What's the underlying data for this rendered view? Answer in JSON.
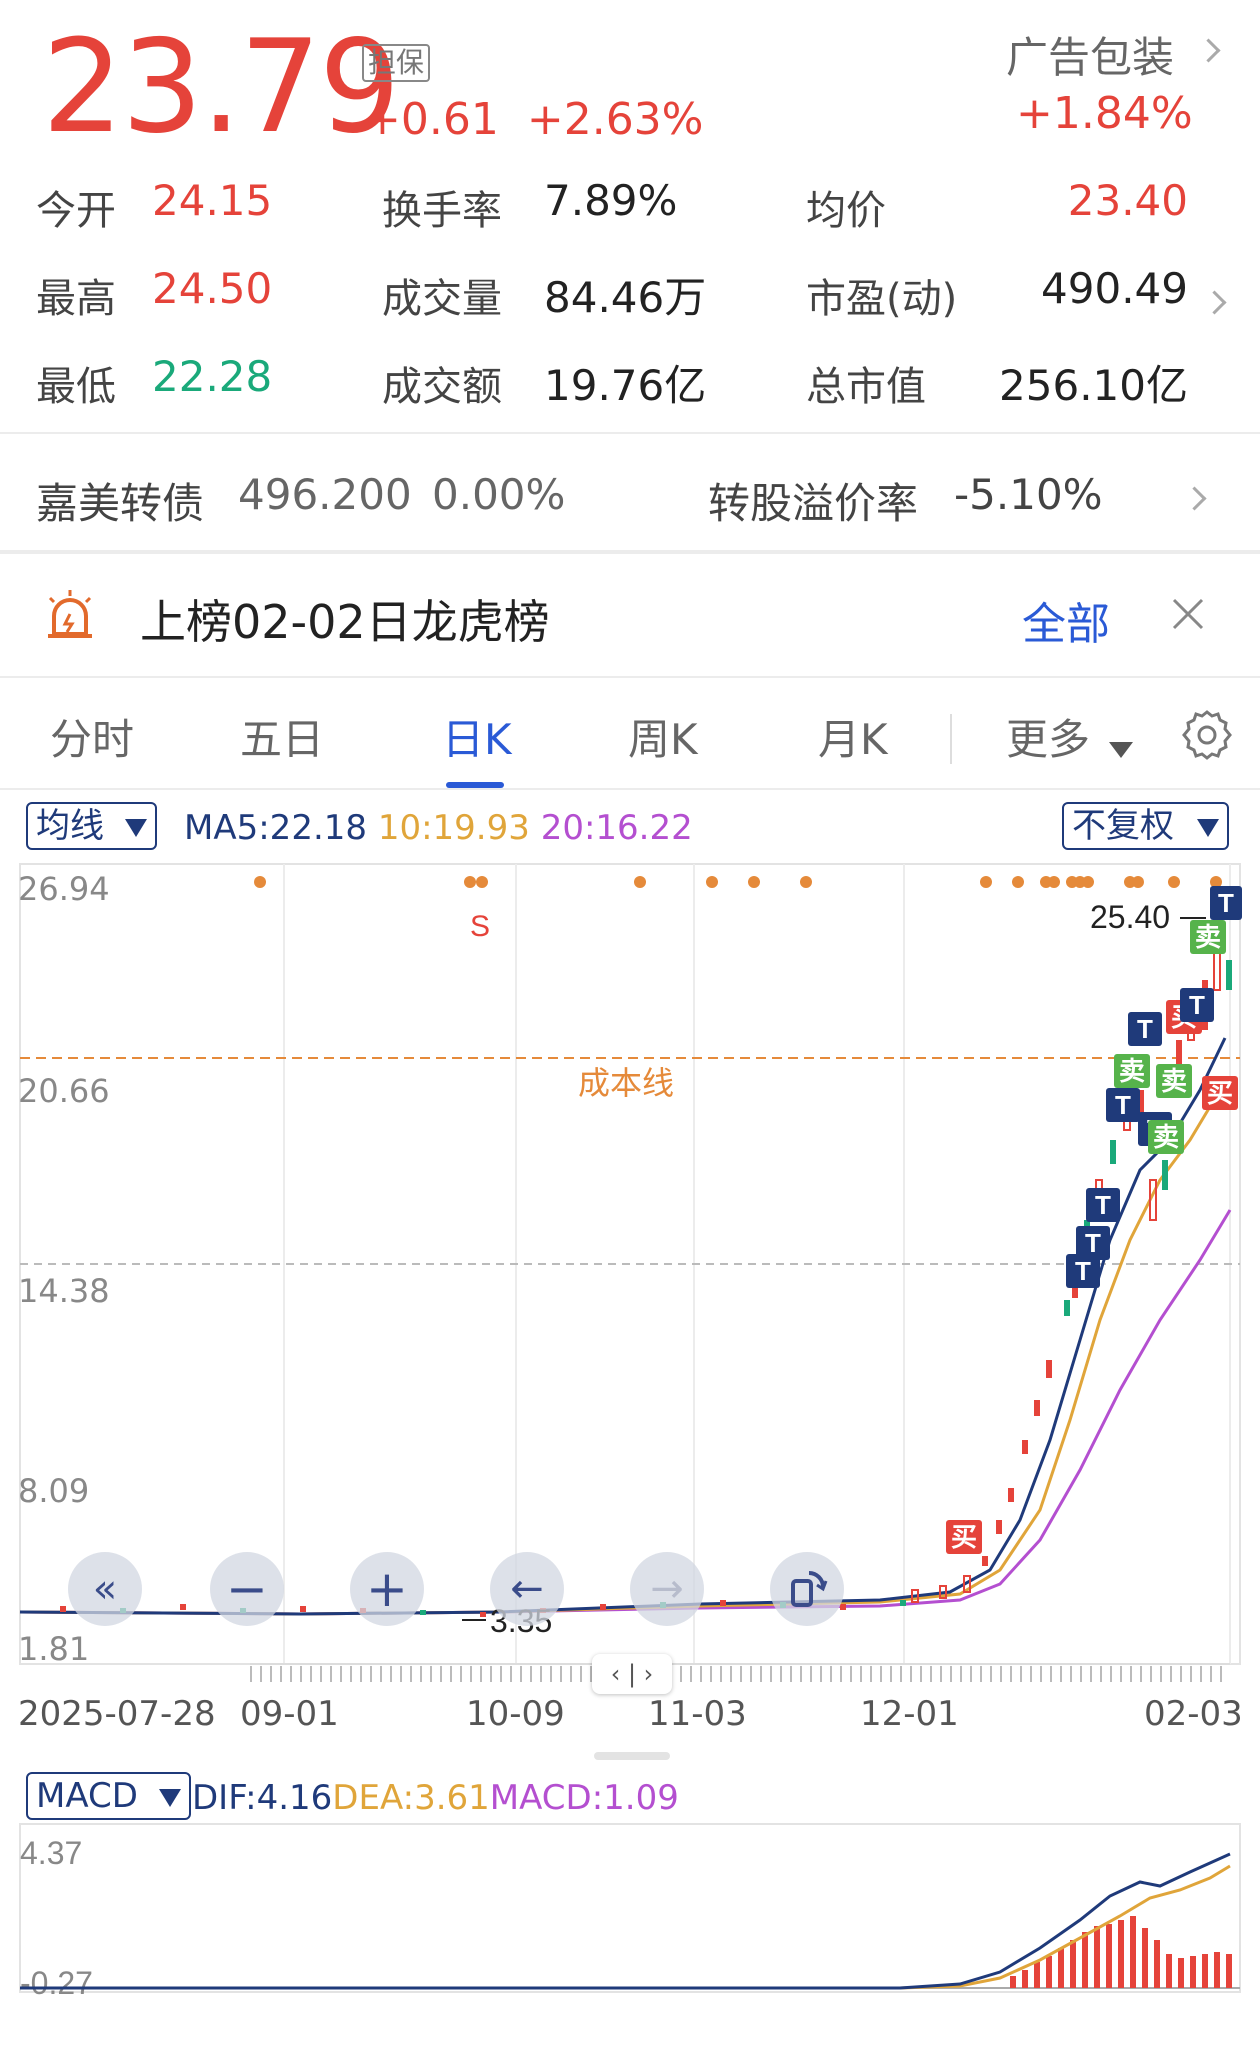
{
  "quote": {
    "price": "23.79",
    "badge": "担保",
    "change": "+0.61",
    "change_pct": "+2.63%",
    "sector_name": "广告包装",
    "sector_pct": "+1.84%"
  },
  "stats": [
    {
      "label": "今开",
      "value": "24.15",
      "color": "red"
    },
    {
      "label": "换手率",
      "value": "7.89%",
      "color": "dark"
    },
    {
      "label": "均价",
      "value": "23.40",
      "color": "red"
    },
    {
      "label": "最高",
      "value": "24.50",
      "color": "red"
    },
    {
      "label": "成交量",
      "value": "84.46万",
      "color": "dark"
    },
    {
      "label": "市盈(动)",
      "value": "490.49",
      "color": "dark"
    },
    {
      "label": "最低",
      "value": "22.28",
      "color": "green"
    },
    {
      "label": "成交额",
      "value": "19.76亿",
      "color": "dark"
    },
    {
      "label": "总市值",
      "value": "256.10亿",
      "color": "dark"
    }
  ],
  "bond": {
    "name": "嘉美转债",
    "price": "496.200",
    "pct": "0.00%",
    "premium_label": "转股溢价率",
    "premium_value": "-5.10%"
  },
  "notice": {
    "text": "上榜02-02日龙虎榜",
    "all_label": "全部",
    "icon": "alarm-icon"
  },
  "tabs": [
    "分时",
    "五日",
    "日K",
    "周K",
    "月K"
  ],
  "active_tab": "日K",
  "more_label": "更多",
  "chart": {
    "ma_selector": "均线",
    "ma5": "MA5:22.18",
    "ma10": "10:19.93",
    "ma20": "20:16.22",
    "adjust_selector": "不复权",
    "y_ticks": [
      "26.94",
      "20.66",
      "14.38",
      "8.09",
      "1.81"
    ],
    "max_marker": "25.40",
    "min_marker": "3.35",
    "cost_line_label": "成本线",
    "s_marker": "S",
    "x_labels": [
      "2025-07-28",
      "09-01",
      "10-09",
      "11-03",
      "12-01",
      "02-03"
    ],
    "flags": {
      "T": "T",
      "buy": "买",
      "sell": "卖"
    }
  },
  "macd": {
    "selector": "MACD",
    "dif": "DIF:4.16",
    "dea": "DEA:3.61",
    "macd": "MACD:1.09",
    "y_ticks": [
      "4.37",
      "-0.27"
    ]
  },
  "colors": {
    "up": "#e5433a",
    "down": "#1aa97a",
    "accent": "#2a5ad6",
    "ma5": "#1f3a7a",
    "ma10": "#e0a53a",
    "ma20": "#b44fd0",
    "cost": "#e58a3a"
  },
  "chart_data": {
    "type": "candlestick",
    "x_labels": [
      "2025-07-28",
      "09-01",
      "10-09",
      "11-03",
      "12-01",
      "02-03"
    ],
    "ylim": [
      1.81,
      26.94
    ],
    "last_close": 23.79,
    "max_high": 25.4,
    "min_low": 3.35,
    "ma": {
      "MA5": 22.18,
      "MA10": 19.93,
      "MA20": 16.22
    },
    "cost_line": 21.0
  }
}
